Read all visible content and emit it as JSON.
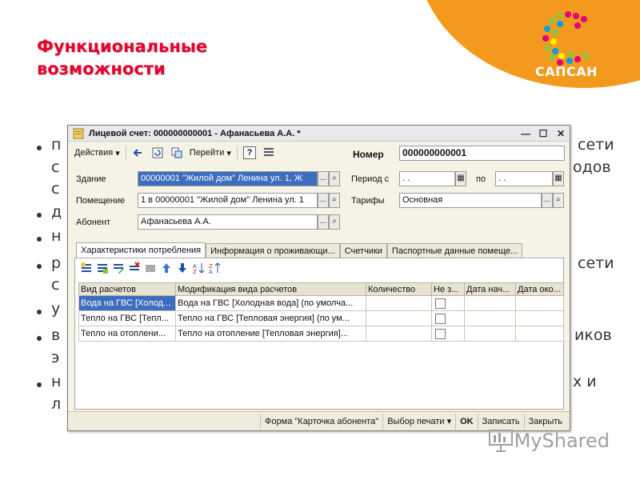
{
  "slide": {
    "title": "Функциональные\nвозможности",
    "title_color": "#e4032e",
    "accent_color": "#f39a1e"
  },
  "logo": {
    "text": "САПСАН"
  },
  "background_text": [
    {
      "left": "п",
      "right": "сети"
    },
    {
      "left": "с",
      "right": "одов"
    },
    {
      "left": "с",
      "right": ""
    },
    {
      "left": "д",
      "right": ""
    },
    {
      "left": "н",
      "right": ""
    },
    {
      "left": "р",
      "right": "сети"
    },
    {
      "left": "с",
      "right": ""
    },
    {
      "left": "у",
      "right": ""
    },
    {
      "left": "в",
      "right": "иков"
    },
    {
      "left": "э",
      "right": ""
    },
    {
      "left": "н",
      "right": "х и"
    },
    {
      "left": "л",
      "right": ""
    }
  ],
  "window": {
    "title": "Лицевой счет: 000000000001 - Афанасьева А.А. *",
    "toolbar": {
      "actions": "Действия",
      "goto": "Перейти",
      "help": "?",
      "number_label": "Номер",
      "number_value": "000000000001"
    },
    "form": {
      "building_label": "Здание",
      "building_value": "00000001 \"Жилой дом\" Ленина ул. 1, Ж",
      "room_label": "Помещение",
      "room_value": "1 в 00000001 \"Жилой дом\" Ленина ул. 1",
      "subscriber_label": "Абонент",
      "subscriber_value": "Афанасьева А.А.",
      "period_label": "Период с",
      "period_from": " .  .",
      "period_to_label": "по",
      "period_to": " .  .",
      "tariff_label": "Тарифы",
      "tariff_value": "Основная",
      "ellipsis": "...",
      "calendar": "▦",
      "search": "🔍"
    },
    "tabs": [
      {
        "label": "Характеристики потребления"
      },
      {
        "label": "Информация о проживающи..."
      },
      {
        "label": "Счетчики"
      },
      {
        "label": "Паспортные данные помеще..."
      }
    ],
    "table": {
      "columns": [
        "Вид расчетов",
        "Модификация вида расчетов",
        "Количество",
        "Не з...",
        "Дата нач...",
        "Дата око..."
      ],
      "rows": [
        [
          "Вода на ГВС [Холод...",
          "Вода на ГВС [Холодная вода] (по умолча...",
          "",
          "",
          "",
          ""
        ],
        [
          "Тепло на ГВС [Тепл...",
          "Тепло на ГВС [Тепловая энергия] (по ум...",
          "",
          "",
          "",
          ""
        ],
        [
          "Тепло на отоплени...",
          "Тепло на отопление [Тепловая энергия]...",
          "",
          "",
          "",
          ""
        ]
      ]
    },
    "statusbar": {
      "form_card": "Форма \"Карточка абонента\"",
      "print_choice": "Выбор печати",
      "ok": "OK",
      "write": "Записать",
      "close": "Закрыть"
    }
  },
  "watermark": {
    "text": "MyShared"
  }
}
